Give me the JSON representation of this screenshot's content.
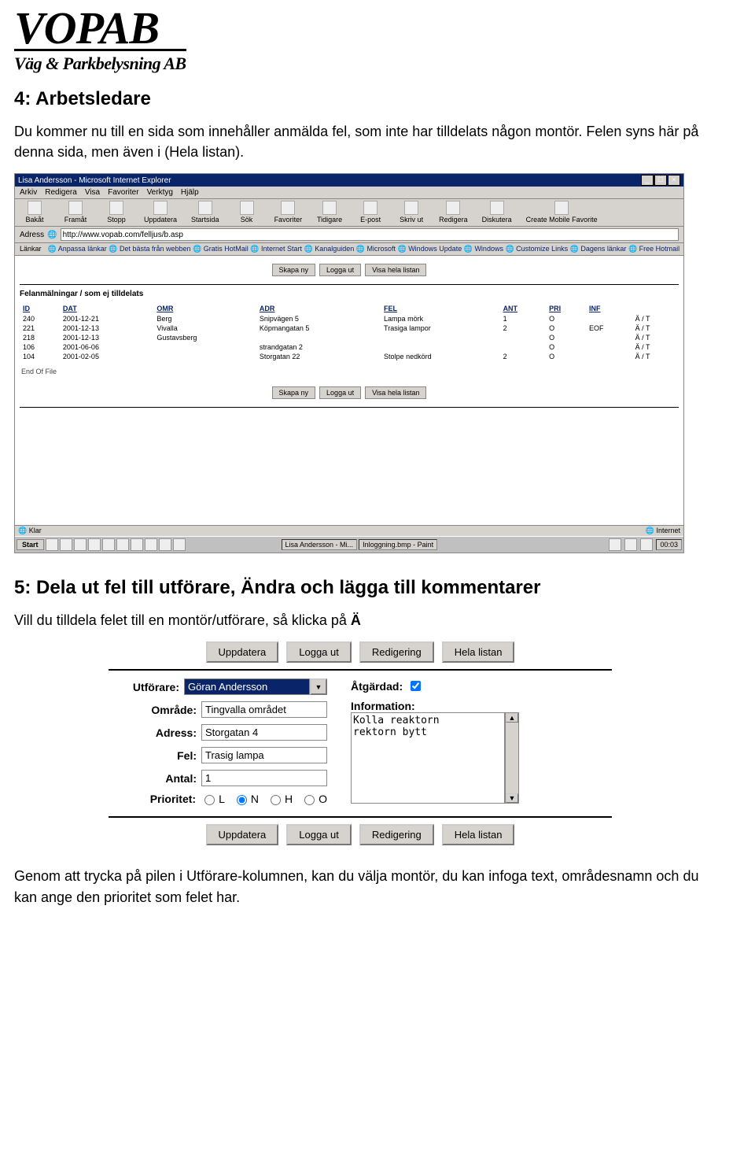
{
  "logo": {
    "main": "VOPAB",
    "sub": "Väg & Parkbelysning AB"
  },
  "section4": {
    "heading": "4: Arbetsledare",
    "para": "Du kommer nu till en sida som innehåller anmälda fel, som inte har tilldelats någon montör. Felen syns här på denna sida, men även i (Hela listan)."
  },
  "browser": {
    "title": "Lisa Andersson - Microsoft Internet Explorer",
    "menus": [
      "Arkiv",
      "Redigera",
      "Visa",
      "Favoriter",
      "Verktyg",
      "Hjälp"
    ],
    "toolbar": [
      "Bakåt",
      "Framåt",
      "Stopp",
      "Uppdatera",
      "Startsida",
      "Sök",
      "Favoriter",
      "Tidigare",
      "E-post",
      "Skriv ut",
      "Redigera",
      "Diskutera",
      "Create Mobile Favorite"
    ],
    "addr_label": "Adress",
    "addr_value": "http://www.vopab.com/felljus/b.asp",
    "link_label": "Länkar",
    "links": [
      "Anpassa länkar",
      "Det bästa från webben",
      "Gratis HotMail",
      "Internet Start",
      "Kanalguiden",
      "Microsoft",
      "Windows Update",
      "Windows",
      "Customize Links",
      "Dagens länkar",
      "Free Hotmail"
    ],
    "top_buttons": [
      "Skapa ny",
      "Logga ut",
      "Visa hela listan"
    ],
    "list_heading": "Felanmälningar / som ej tilldelats",
    "columns": [
      "ID",
      "DAT",
      "OMR",
      "ADR",
      "FEL",
      "ANT",
      "PRI",
      "INF",
      ""
    ],
    "rows": [
      {
        "c": [
          "240",
          "2001-12-21",
          "Berg",
          "Snipvägen 5",
          "Lampa mörk",
          "1",
          "O",
          "",
          "Ä / T"
        ]
      },
      {
        "c": [
          "221",
          "2001-12-13",
          "Vivalla",
          "Köpmangatan 5",
          "Trasiga lampor",
          "2",
          "O",
          "EOF",
          "Ä / T"
        ]
      },
      {
        "c": [
          "218",
          "2001-12-13",
          "Gustavsberg",
          "",
          "",
          "",
          "O",
          "",
          "Ä / T"
        ]
      },
      {
        "c": [
          "106",
          "2001-06-06",
          "",
          "strandgatan 2",
          "",
          "",
          "O",
          "",
          "Ä / T"
        ]
      },
      {
        "c": [
          "104",
          "2001-02-05",
          "",
          "Storgatan 22",
          "Stolpe nedkörd",
          "2",
          "O",
          "",
          "Ä / T"
        ]
      }
    ],
    "eof": "End Of File",
    "status_left": "Klar",
    "status_right": "Internet",
    "taskbar": {
      "start": "Start",
      "task1": "Lisa Andersson - Mi...",
      "task2": "Inloggning.bmp - Paint",
      "clock": "00:03"
    }
  },
  "section5": {
    "heading": "5: Dela ut fel till utförare, Ändra och lägga till kommentarer",
    "para_before": "Vill du tilldela felet till en montör/utförare, så klicka på ",
    "para_bold": "Ä"
  },
  "form": {
    "buttons": [
      "Uppdatera",
      "Logga ut",
      "Redigering",
      "Hela listan"
    ],
    "labels": {
      "utforare": "Utförare:",
      "omrade": "Område:",
      "adress": "Adress:",
      "fel": "Fel:",
      "antal": "Antal:",
      "prioritet": "Prioritet:",
      "atgardad": "Åtgärdad:",
      "information": "Information:"
    },
    "values": {
      "utforare": "Göran Andersson",
      "omrade": "Tingvalla området",
      "adress": "Storgatan 4",
      "fel": "Trasig lampa",
      "antal": "1",
      "info": "Kolla reaktorn\nrektorn bytt"
    },
    "prio_options": [
      "L",
      "N",
      "H",
      "O"
    ],
    "prio_checked": "N",
    "atgardad_checked": true
  },
  "footer": "Genom att trycka på pilen i Utförare-kolumnen, kan du välja montör, du kan infoga text, områdesnamn och du kan ange den prioritet som felet har."
}
